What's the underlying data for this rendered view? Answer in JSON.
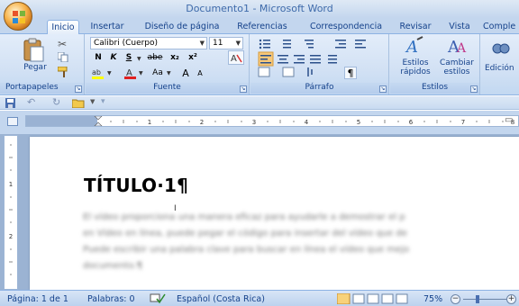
{
  "window": {
    "title": "Documento1 - Microsoft Word"
  },
  "tabs": [
    "Inicio",
    "Insertar",
    "Diseño de página",
    "Referencias",
    "Correspondencia",
    "Revisar",
    "Vista",
    "Comple"
  ],
  "ribbon": {
    "clipboard": {
      "label": "Portapapeles",
      "paste_label": "Pegar"
    },
    "font": {
      "label": "Fuente",
      "font_name": "Calibri (Cuerpo)",
      "font_size": "11",
      "bold": "N",
      "italic": "K",
      "underline": "S",
      "strike": "abe",
      "subscript": "x₂",
      "superscript": "x²",
      "grow": "A",
      "shrink": "A",
      "case": "Aa"
    },
    "paragraph": {
      "label": "Párrafo",
      "pilcrow": "¶"
    },
    "styles": {
      "label": "Estilos",
      "quick_styles_1": "Estilos",
      "quick_styles_2": "rápidos",
      "change_styles_1": "Cambiar",
      "change_styles_2": "estilos"
    },
    "editing": {
      "label": "Edición"
    }
  },
  "document": {
    "heading": "TÍTULO·1¶",
    "body_lines": [
      "El vídeo proporciona una manera eficaz para ayudarle a demostrar el p",
      "en Vídeo en línea, puede pegar el código para insertar del vídeo que de",
      "Puede escribir una palabra clave para buscar en línea el vídeo que mejo",
      "documento.¶"
    ]
  },
  "status": {
    "page": "Página: 1 de 1",
    "words": "Palabras: 0",
    "language": "Español (Costa Rica)",
    "zoom": "75%"
  }
}
